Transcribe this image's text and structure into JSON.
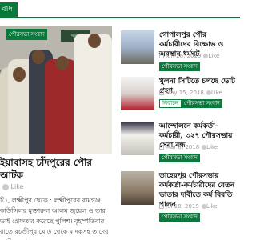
{
  "topbar": {
    "tab_label": "বাদ"
  },
  "feature": {
    "category": "পৌরসভা সংবাদ",
    "photo_board_text": "থানা",
    "title": "ইয়াবাসহ চাঁদপুরের পৌর আটক",
    "meta_likes": "Like",
    "excerpt": "ি, লক্ষ্মীপুর থেকে : লক্ষ্মীপুরের রামগঞ্জ কাউন্সিলর মুক্তারুল আলম জুয়েল ও তার ভাই গ্রেফতার করেছে পুলিশ। বৃহস্পতিবার রাতে রচণ্ডীপুর মোড় থেকে মাদকসহ তাদের আটক করা হয়।"
  },
  "items": [
    {
      "title": "গোপালপুর পৌর কর্মচারীদের বিক্ষোভ ও অবস্থান ধর্মঘট",
      "date": "Jun 26, 2019",
      "likes": "Like",
      "badge": "পৌরসভা সংবাদ",
      "badge_style": "solid"
    },
    {
      "title": "খুলনা সিটিতে চলছে ভোট গ্রহণ",
      "date": "May 15, 2018",
      "likes": "Like",
      "badge": "নির্বাচন",
      "badge2": "পৌরসভা সংবাদ",
      "badge_style": "alt"
    },
    {
      "title": "আন্দোলনে কর্মকর্তা-কর্মচারী, ৩২৭ পৌরসভায় সেবা বন্ধ",
      "date": "Mar 8, 2018",
      "likes": "Like",
      "badge": "পৌরসভা সংবাদ",
      "badge_style": "solid"
    },
    {
      "title": "তাহেরপুর পৌরসভার কর্মকর্তা-কর্মচারীদের বেতন ভাতার দাবীতে কর্ম বিরতি পালন",
      "date": "Jul 18, 2019",
      "likes": "Like",
      "badge": "পৌরসভা সংবাদ",
      "badge_style": "solid"
    }
  ]
}
